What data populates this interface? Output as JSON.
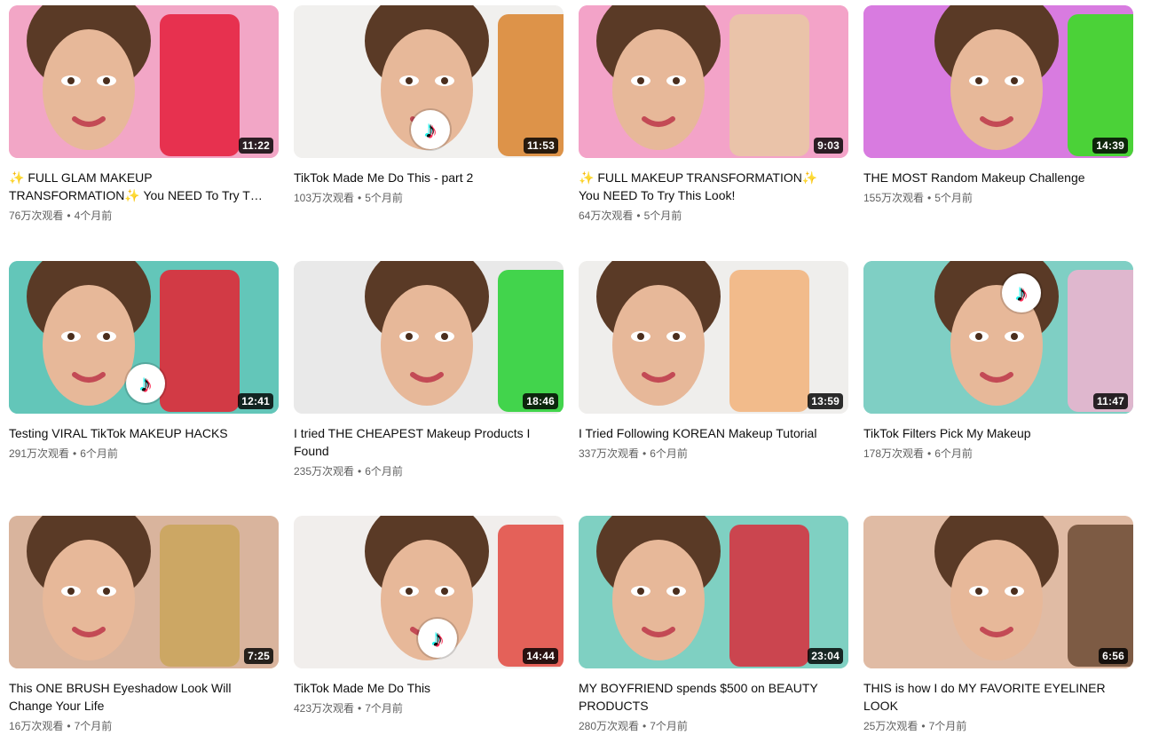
{
  "videos": [
    {
      "title": "✨ FULL GLAM MAKEUP TRANSFORMATION✨ You NEED To Try This Look!",
      "views": "76万次观看",
      "age": "4个月前",
      "duration": "11:22",
      "bg": "#f2a6c6",
      "accent": "#e51c3a",
      "tiktok": false
    },
    {
      "title": "TikTok Made Me Do This - part 2",
      "views": "103万次观看",
      "age": "5个月前",
      "duration": "11:53",
      "bg": "#f1f0ee",
      "accent": "#d9822b",
      "tiktok": true
    },
    {
      "title": "✨ FULL MAKEUP TRANSFORMATION✨ You NEED To Try This Look!",
      "views": "64万次观看",
      "age": "5个月前",
      "duration": "9:03",
      "bg": "#f3a3c8",
      "accent": "#e8c9a3",
      "tiktok": false
    },
    {
      "title": "THE MOST Random Makeup Challenge",
      "views": "155万次观看",
      "age": "5个月前",
      "duration": "14:39",
      "bg": "#d87be0",
      "accent": "#33e21a",
      "tiktok": false
    },
    {
      "title": "Testing VIRAL TikTok MAKEUP HACKS",
      "views": "291万次观看",
      "age": "6个月前",
      "duration": "12:41",
      "bg": "#63c6b9",
      "accent": "#e52130",
      "tiktok": true
    },
    {
      "title": "I tried THE CHEAPEST Makeup Products I Found",
      "views": "235万次观看",
      "age": "6个月前",
      "duration": "18:46",
      "bg": "#e9e9e9",
      "accent": "#25d030",
      "tiktok": false
    },
    {
      "title": "I Tried Following KOREAN Makeup Tutorial",
      "views": "337万次观看",
      "age": "6个月前",
      "duration": "13:59",
      "bg": "#efeeec",
      "accent": "#f2b27a",
      "tiktok": false
    },
    {
      "title": "TikTok Filters Pick My Makeup",
      "views": "178万次观看",
      "age": "6个月前",
      "duration": "11:47",
      "bg": "#7fcfc4",
      "accent": "#f0b3d0",
      "tiktok": true
    },
    {
      "title": "This ONE BRUSH Eyeshadow Look Will Change Your Life",
      "views": "16万次观看",
      "age": "7个月前",
      "duration": "7:25",
      "bg": "#d9b49d",
      "accent": "#c9a45a",
      "tiktok": false
    },
    {
      "title": "TikTok Made Me Do This",
      "views": "423万次观看",
      "age": "7个月前",
      "duration": "14:44",
      "bg": "#f1eeec",
      "accent": "#e2483f",
      "tiktok": true
    },
    {
      "title": "MY BOYFRIEND spends $500 on BEAUTY PRODUCTS",
      "views": "280万次观看",
      "age": "7个月前",
      "duration": "23:04",
      "bg": "#7fd0c2",
      "accent": "#d82d3b",
      "tiktok": false
    },
    {
      "title": "THIS is how I do MY FAVORITE EYELINER LOOK",
      "views": "25万次观看",
      "age": "7个月前",
      "duration": "6:56",
      "bg": "#e0bba4",
      "accent": "#6b4a34",
      "tiktok": false
    }
  ],
  "tiktok_glyph": "♪",
  "separator": "•"
}
